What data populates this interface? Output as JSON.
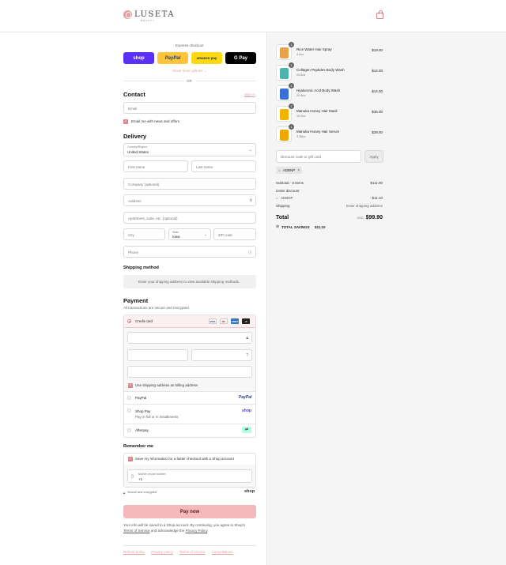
{
  "brand": {
    "name": "LUSETA",
    "sub": "BEAUTY"
  },
  "express": {
    "label": "Express checkout",
    "shop": "shop",
    "paypal": "PayPal",
    "amazon": "amazon pay",
    "gpay": "G Pay",
    "more": "Show more options ⌄",
    "or": "OR"
  },
  "contact": {
    "title": "Contact",
    "login": "Sign in",
    "email_placeholder": "Email",
    "news_label": "Email me with news and offers"
  },
  "delivery": {
    "title": "Delivery",
    "country_label": "Country/Region",
    "country_value": "United States",
    "first_name": "First name",
    "last_name": "Last name",
    "company": "Company (optional)",
    "address": "Address",
    "apartment": "Apartment, suite, etc. (optional)",
    "city": "City",
    "state_label": "State",
    "state_value": "Iowa",
    "zip": "ZIP code",
    "phone": "Phone"
  },
  "shipping_method": {
    "title": "Shipping method",
    "message": "Enter your shipping address to view available shipping methods."
  },
  "payment": {
    "title": "Payment",
    "subtitle": "All transactions are secure and encrypted.",
    "credit_card": "Credit card",
    "cards": [
      "VISA",
      "MC",
      "AMEX",
      "+5"
    ],
    "billing_label": "Use shipping address as billing address",
    "paypal": "PayPal",
    "paypal_logo": "PayPal",
    "shoppay": "Shop Pay",
    "shoppay_sub": "Pay in full or in installments",
    "shoppay_logo": "shop",
    "afterpay": "Afterpay"
  },
  "remember": {
    "title": "Remember me",
    "save_label": "Save my information for a faster checkout with a Shop account",
    "phone_label": "Mobile phone number",
    "phone_value": "+1",
    "secure": "Secure and encrypted",
    "shop_logo": "shop"
  },
  "pay_button": "Pay now",
  "terms": {
    "line1": "Your info will be saved to a Shop account. By continuing, you agree to Shop's",
    "tos": "Terms of Service",
    "mid": " and acknowledge the ",
    "privacy": "Privacy Policy",
    "end": "."
  },
  "footer": [
    "Refund policy",
    "Privacy policy",
    "Terms of service",
    "Cancellations"
  ],
  "products": [
    {
      "name": "Rice Water Hair Spray",
      "variant": "4.5oz",
      "price": "$19.00",
      "qty": "1",
      "color": "#e8a24a"
    },
    {
      "name": "Collagen Peptides Body Wash",
      "variant": "20.8oz",
      "price": "$14.00",
      "qty": "1",
      "color": "#4fb3b0"
    },
    {
      "name": "Hyaluronic Acid Body Wash",
      "variant": "20.8oz",
      "price": "$14.00",
      "qty": "1",
      "color": "#3a6fd8"
    },
    {
      "name": "Manuka Honey Hair Mask",
      "variant": "16.9oz",
      "price": "$36.00",
      "qty": "1",
      "color": "#f0b400"
    },
    {
      "name": "Manuka Honey Hair Serum",
      "variant": "3.38oz",
      "price": "$28.00",
      "qty": "1",
      "color": "#f0a800"
    }
  ],
  "discount": {
    "placeholder": "Discount code or gift card",
    "apply": "Apply",
    "code": "ADBNP"
  },
  "summary": {
    "subtotal_label": "Subtotal · 5 items",
    "subtotal": "$111.00",
    "order_discount": "Order discount",
    "discount_code": "ADBNP",
    "discount_value": "- $11.10",
    "shipping_label": "Shipping",
    "shipping_value": "Enter shipping address",
    "total_label": "Total",
    "currency": "USD",
    "total": "$99.90",
    "savings_label": "TOTAL SAVINGS",
    "savings": "$11.10"
  }
}
